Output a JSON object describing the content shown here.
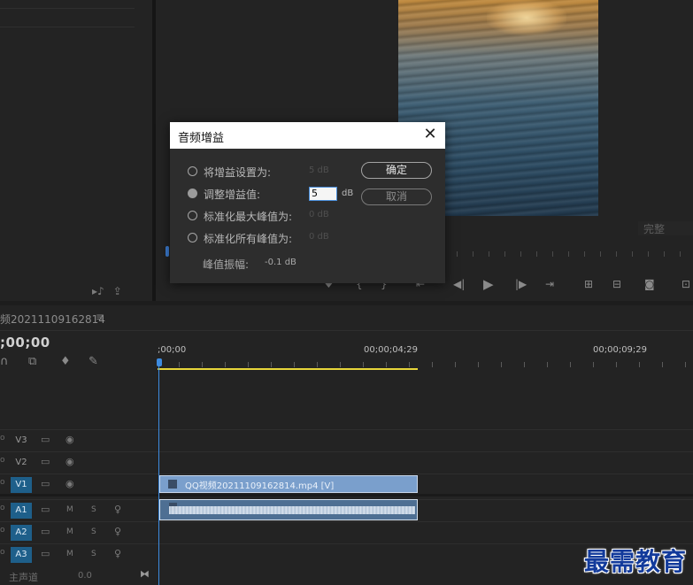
{
  "monitor": {
    "quality": "完整"
  },
  "sequence": {
    "name": "频20211109162814",
    "current_timecode": ";00;00",
    "ruler_labels": [
      ";00;00",
      "00;00;04;29",
      "00;00;09;29"
    ]
  },
  "tracks": {
    "video": [
      {
        "name": "V3",
        "active": false
      },
      {
        "name": "V2",
        "active": false
      },
      {
        "name": "V1",
        "active": true
      }
    ],
    "audio": [
      {
        "name": "A1",
        "active": true,
        "m": "M",
        "s": "S"
      },
      {
        "name": "A2",
        "active": true,
        "m": "M",
        "s": "S"
      },
      {
        "name": "A3",
        "active": true,
        "m": "M",
        "s": "S"
      }
    ],
    "master": {
      "label": "主声道",
      "value": "0.0"
    }
  },
  "clips": {
    "video_clip_name": "QQ视频20211109162814.mp4 [V]"
  },
  "dialog": {
    "title": "音频增益",
    "options": [
      {
        "label": "将增益设置为:",
        "value": "5 dB",
        "selected": false
      },
      {
        "label": "调整增益值:",
        "value": "5",
        "unit": "dB",
        "selected": true
      },
      {
        "label": "标准化最大峰值为:",
        "value": "0 dB",
        "selected": false
      },
      {
        "label": "标准化所有峰值为:",
        "value": "0 dB",
        "selected": false
      }
    ],
    "ok_label": "确定",
    "cancel_label": "取消",
    "peak_label": "峰值振幅:",
    "peak_value": "-0.1 dB"
  },
  "watermark": "最需教育",
  "colors": {
    "accent_blue": "#3d8be0",
    "track_active": "#1e5f8a",
    "video_clip": "#7a9fcc",
    "audio_clip": "#4e6f93",
    "work_area": "#e7d63a"
  }
}
